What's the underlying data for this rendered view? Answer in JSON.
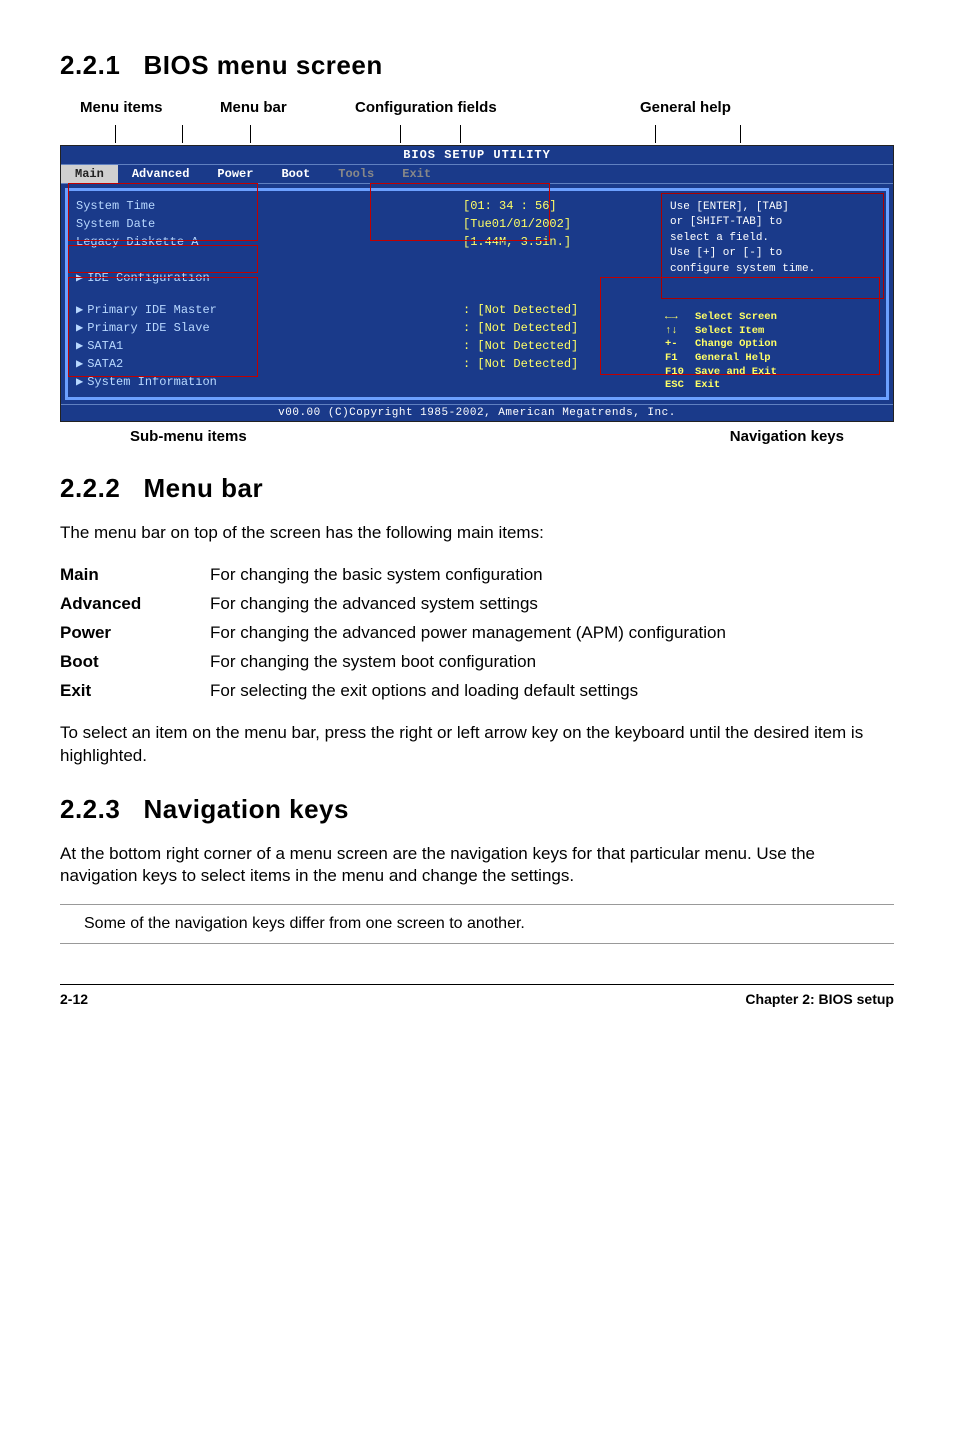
{
  "sections": {
    "s1": {
      "num": "2.2.1",
      "title": "BIOS menu screen"
    },
    "s2": {
      "num": "2.2.2",
      "title": "Menu bar"
    },
    "s3": {
      "num": "2.2.3",
      "title": "Navigation keys"
    }
  },
  "top_labels": {
    "menu_items": "Menu items",
    "menu_bar": "Menu bar",
    "config_fields": "Configuration fields",
    "general_help": "General help"
  },
  "bottom_labels": {
    "submenu": "Sub-menu items",
    "navkeys": "Navigation keys"
  },
  "bios": {
    "title": "BIOS SETUP UTILITY",
    "tabs": [
      "Main",
      "Advanced",
      "Power",
      "Boot",
      "Tools",
      "Exit"
    ],
    "fields": {
      "system_time": {
        "label": "System Time",
        "value": "[01: 34 : 56]"
      },
      "system_date": {
        "label": "System Date",
        "value": "[Tue01/01/2002]"
      },
      "legacy_diskette": {
        "label": "Legacy Diskette A",
        "value": "[1.44M, 3.5in.]"
      },
      "ide_config": {
        "label": "IDE Configuration"
      },
      "primary_master": {
        "label": "Primary IDE Master",
        "value": ": [Not Detected]"
      },
      "primary_slave": {
        "label": "Primary IDE Slave",
        "value": ": [Not Detected]"
      },
      "sata1": {
        "label": "SATA1",
        "value": ": [Not Detected]"
      },
      "sata2": {
        "label": "SATA2",
        "value": ": [Not Detected]"
      },
      "sysinfo": {
        "label": "System Information"
      }
    },
    "help": {
      "l1": "Use [ENTER], [TAB]",
      "l2": "or [SHIFT-TAB] to",
      "l3": "select a field.",
      "l4": "Use [+] or [-] to",
      "l5": "configure system time."
    },
    "nav": [
      {
        "key": "←→",
        "desc": "Select Screen"
      },
      {
        "key": "↑↓",
        "desc": "Select Item"
      },
      {
        "key": "+-",
        "desc": "Change Option"
      },
      {
        "key": "F1",
        "desc": "General Help"
      },
      {
        "key": "F10",
        "desc": "Save and Exit"
      },
      {
        "key": "ESC",
        "desc": "Exit"
      }
    ],
    "footer": "v00.00 (C)Copyright 1985-2002, American Megatrends, Inc."
  },
  "menubar_intro": "The menu bar on top of the screen has the following main items:",
  "menubar_items": [
    {
      "k": "Main",
      "v": "For changing the basic system configuration"
    },
    {
      "k": "Advanced",
      "v": "For changing the advanced system settings"
    },
    {
      "k": "Power",
      "v": "For changing the advanced power management (APM) configuration"
    },
    {
      "k": "Boot",
      "v": "For changing the system boot configuration"
    },
    {
      "k": "Exit",
      "v": "For selecting the exit options and loading default settings"
    }
  ],
  "menubar_outro": "To select an item on the menu bar, press the right or left arrow key on the keyboard until the desired item is highlighted.",
  "navkeys_para": "At the bottom right corner of a menu screen are the navigation keys for that particular menu. Use the navigation keys to select items in the menu and change the settings.",
  "note": "Some of the navigation keys differ from one screen to another.",
  "footer": {
    "page": "2-12",
    "chapter": "Chapter 2: BIOS setup"
  }
}
